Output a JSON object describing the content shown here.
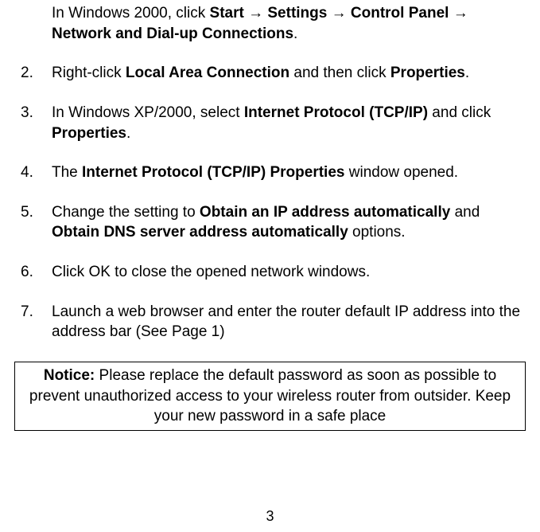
{
  "arrow": "→",
  "item1_continued": {
    "t1": "In Windows 2000, click ",
    "b1": "Start ",
    "b2": " Settings ",
    "b3": " Control Panel ",
    "b4": " Network and Dial-up Connections",
    "t_end": "."
  },
  "item2": {
    "num": "2.",
    "t1": "Right-click ",
    "b1": "Local Area Connection",
    "t2": " and then click ",
    "b2": "Properties",
    "t3": "."
  },
  "item3": {
    "num": "3.",
    "t1": "In Windows XP/2000, select ",
    "b1": "Internet Protocol (TCP/IP)",
    "t2": " and click ",
    "b2": "Properties",
    "t3": "."
  },
  "item4": {
    "num": "4.",
    "t1": "The ",
    "b1": "Internet Protocol (TCP/IP) Properties",
    "t2": " window opened."
  },
  "item5": {
    "num": "5.",
    "t1": "Change the setting to ",
    "b1": "Obtain an IP address automatically",
    "t2": " and ",
    "b2": "Obtain DNS server address automatically",
    "t3": " options."
  },
  "item6": {
    "num": "6.",
    "t1": "Click OK to close the opened network windows."
  },
  "item7": {
    "num": "7.",
    "t1": "Launch a web browser and enter the router default IP address into the address bar (See Page 1)"
  },
  "notice": {
    "b1": "Notice:",
    "t1": " Please replace the default password as soon as possible to prevent unauthorized access to your wireless router from outsider. Keep your new password in a safe place"
  },
  "page_number": "3"
}
